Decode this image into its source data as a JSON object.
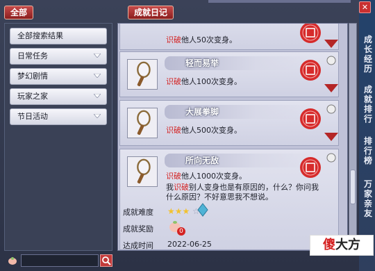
{
  "top_tabs": {
    "all": "全部",
    "diary": "成就日记"
  },
  "categories": [
    {
      "label": "全部搜索结果",
      "has_dropdown": false
    },
    {
      "label": "日常任务",
      "has_dropdown": true
    },
    {
      "label": "梦幻剧情",
      "has_dropdown": true
    },
    {
      "label": "玩家之家",
      "has_dropdown": true
    },
    {
      "label": "节日活动",
      "has_dropdown": true
    }
  ],
  "search": {
    "value": "",
    "icon": "magnifier-icon"
  },
  "achievements": [
    {
      "title": "",
      "desc_kw": "识破",
      "desc_rest": "他人50次变身。",
      "seal": "red-seal-icon"
    },
    {
      "title": "轻而易举",
      "desc_kw": "识破",
      "desc_rest": "他人100次变身。",
      "seal": "red-seal-icon"
    },
    {
      "title": "大展拳脚",
      "desc_kw": "识破",
      "desc_rest": "他人500次变身。",
      "seal": "red-seal-icon"
    },
    {
      "title": "所向无敌",
      "desc_kw": "识破",
      "desc_rest": "他人1000次变身。",
      "seal": "red-seal-icon",
      "detail_pre": "我",
      "detail_kw": "识破",
      "detail_rest": "别人变身也是有原因的，什么？你问我什么原因？不好意思我不想说。",
      "difficulty_label": "成就难度",
      "difficulty_stars": 3,
      "difficulty_max": 5,
      "reward_label": "成就奖励",
      "reward_count": "0",
      "date_label": "达成时间",
      "date_value": "2022-06-25"
    }
  ],
  "side_labels": [
    "成长经历",
    "成就排行",
    "排行榜",
    "万家亲友"
  ],
  "watermark": {
    "red": "傻",
    "black": "大方"
  },
  "colors": {
    "tab_red": "#b83232",
    "keyword_red": "#d42222",
    "card_bg": "#d8d9e8"
  }
}
